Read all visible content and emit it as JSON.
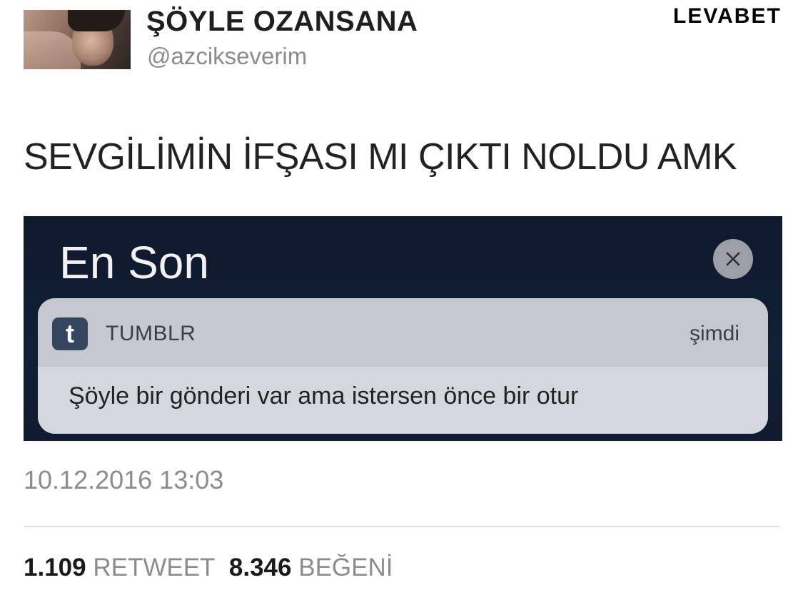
{
  "user": {
    "display_name": "ŞÖYLE OZANSANA",
    "handle": "@azcikseverim"
  },
  "brand": "LEVABET",
  "tweet": {
    "text": "SEVGİLİMİN İFŞASI MI ÇIKTI NOLDU AMK"
  },
  "embedded_screenshot": {
    "title": "En Son",
    "notification": {
      "app_icon_letter": "t",
      "app_name": "TUMBLR",
      "time": "şimdi",
      "message": "Şöyle bir gönderi var ama istersen önce bir otur"
    }
  },
  "timestamp": "10.12.2016 13:03",
  "stats": {
    "retweet_count": "1.109",
    "retweet_label": "RETWEET",
    "like_count": "8.346",
    "like_label": "BEĞENİ"
  },
  "colors": {
    "screenshot_bg": "#112036",
    "card_bg": "#c9ccd3",
    "tumblr_icon": "#34465d",
    "muted_text": "#8c8c8c"
  },
  "icons": [
    "avatar-photo",
    "close-icon",
    "tumblr-icon"
  ]
}
